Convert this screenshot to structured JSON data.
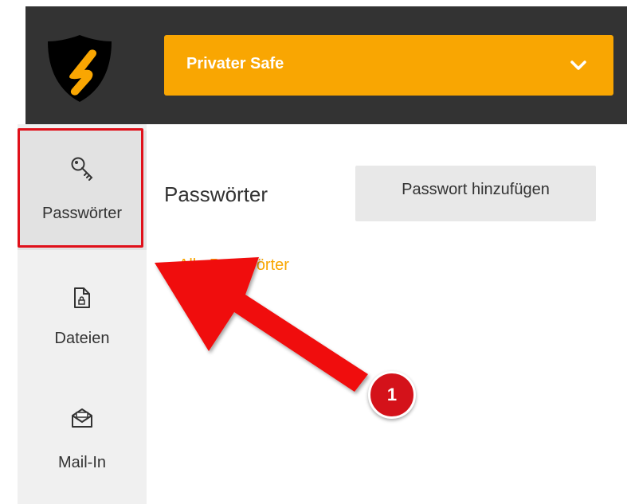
{
  "header": {
    "safe_selector": {
      "label": "Privater Safe",
      "icon": "chevron-down-icon"
    },
    "logo_icon": "shield-logo-icon",
    "colors": {
      "bar": "#333333",
      "accent": "#f9a602"
    }
  },
  "sidebar": {
    "items": [
      {
        "label": "Passwörter",
        "icon": "key-icon",
        "active": true
      },
      {
        "label": "Dateien",
        "icon": "locked-file-icon",
        "active": false
      },
      {
        "label": "Mail-In",
        "icon": "mail-inbox-icon",
        "active": false
      }
    ]
  },
  "main": {
    "title": "Passwörter",
    "add_button_label": "Passwort hinzufügen",
    "filter_link_label": "Alle Passwörter"
  },
  "annotation": {
    "badge_number": "1",
    "color": "#e0101a"
  }
}
